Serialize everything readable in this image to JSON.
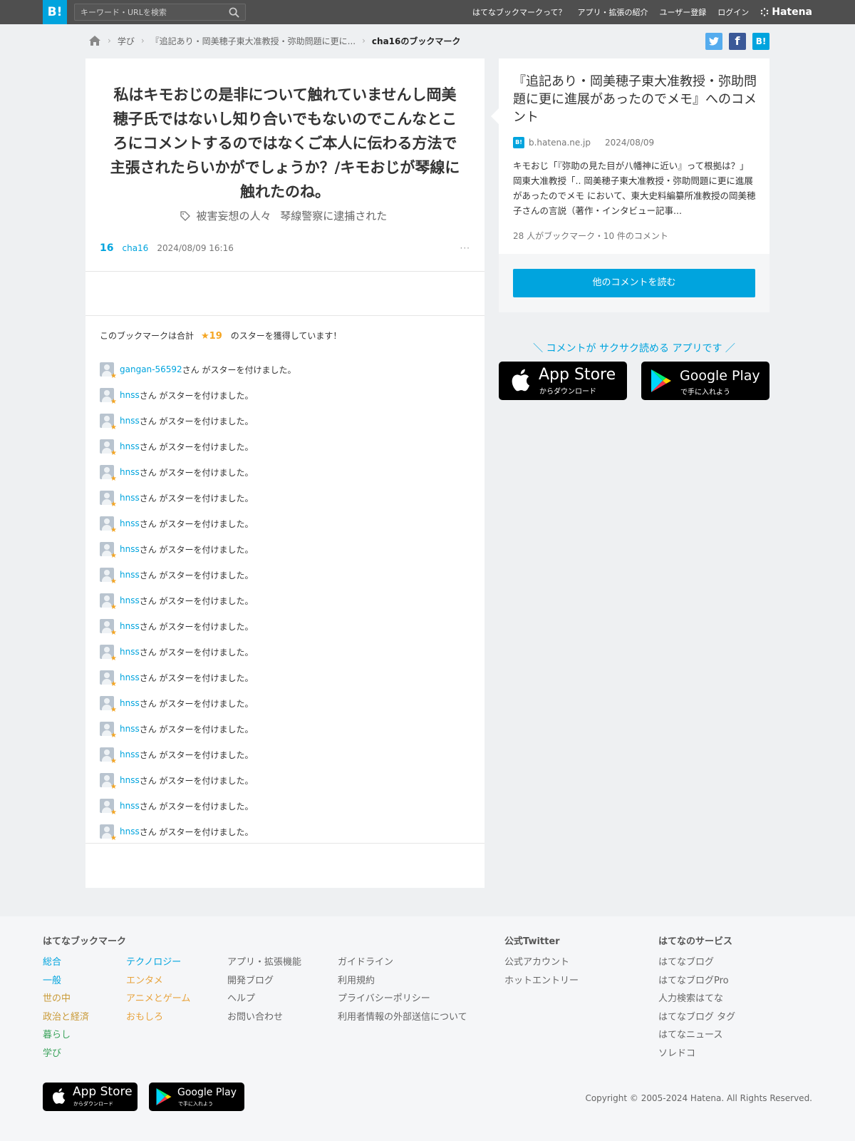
{
  "header": {
    "logo": "B!",
    "search_placeholder": "キーワード・URLを検索",
    "nav": [
      "はてなブックマークって？",
      "アプリ・拡張の紹介",
      "ユーザー登録",
      "ログイン"
    ],
    "brand": "Hatena"
  },
  "breadcrumb": {
    "items": [
      "学び",
      "『追記あり・岡美穂子東大准教授・弥助問題に更に...",
      "cha16のブックマーク"
    ]
  },
  "share": {
    "twitter_color": "#55acee",
    "facebook_color": "#3b5998",
    "hatena_color": "#00a4de",
    "hatena_label": "B!"
  },
  "bookmark": {
    "comment": "私はキモおじの是非について触れていませんし岡美穂子氏ではないし知り合いでもないのでこんなところにコメントするのではなくご本人に伝わる方法で主張されたらいかがでしょうか？/キモおじが琴線に触れたのね。",
    "tags": [
      "被害妄想の人々",
      "琴線警察に逮捕された"
    ],
    "count": "16",
    "user": "cha16",
    "date": "2024/08/09 16:16",
    "more": "···"
  },
  "stars": {
    "summary_prefix": "このブックマークは合計",
    "summary_count": "★19",
    "summary_suffix": "のスターを獲得しています！",
    "action_text": "さん がスターを付けました。",
    "users": [
      "gangan-56592",
      "hnss",
      "hnss",
      "hnss",
      "hnss",
      "hnss",
      "hnss",
      "hnss",
      "hnss",
      "hnss",
      "hnss",
      "hnss",
      "hnss",
      "hnss",
      "hnss",
      "hnss",
      "hnss",
      "hnss",
      "hnss"
    ]
  },
  "entry": {
    "title": "『追記あり・岡美穂子東大准教授・弥助問題に更に進展があったのでメモ』へのコメント",
    "domain": "b.hatena.ne.jp",
    "date": "2024/08/09",
    "excerpt": "キモおじ「『弥助の見た目が八幡神に近い』って根拠は？」 岡東大准教授「.. 岡美穂子東大准教授・弥助問題に更に進展があったのでメモ において、東大史料編纂所准教授の岡美穂子さんの言説（著作・インタビュー記事...",
    "meta": "28 人がブックマーク・10 件のコメント",
    "button": "他のコメントを読む"
  },
  "promo": {
    "text": "＼ コメントが サクサク読める アプリです ／",
    "appstore_title": "App Store",
    "appstore_sub": "からダウンロード",
    "googleplay_title": "Google Play",
    "googleplay_sub": "で手に入れよう"
  },
  "footer": {
    "heading_main": "はてなブックマーク",
    "categories_col1": [
      "総合",
      "一般",
      "世の中",
      "政治と経済",
      "暮らし",
      "学び"
    ],
    "categories_col2": [
      "テクノロジー",
      "エンタメ",
      "アニメとゲーム",
      "おもしろ"
    ],
    "links_col3": [
      "アプリ・拡張機能",
      "開発ブログ",
      "ヘルプ",
      "お問い合わせ"
    ],
    "links_col4": [
      "ガイドライン",
      "利用規約",
      "プライバシーポリシー",
      "利用者情報の外部送信について"
    ],
    "heading_twitter": "公式Twitter",
    "twitter_links": [
      "公式アカウント",
      "ホットエントリー"
    ],
    "heading_services": "はてなのサービス",
    "services": [
      "はてなブログ",
      "はてなブログPro",
      "人力検索はてな",
      "はてなブログ タグ",
      "はてなニュース",
      "ソレドコ"
    ],
    "copyright": "Copyright © 2005-2024 Hatena. All Rights Reserved."
  }
}
